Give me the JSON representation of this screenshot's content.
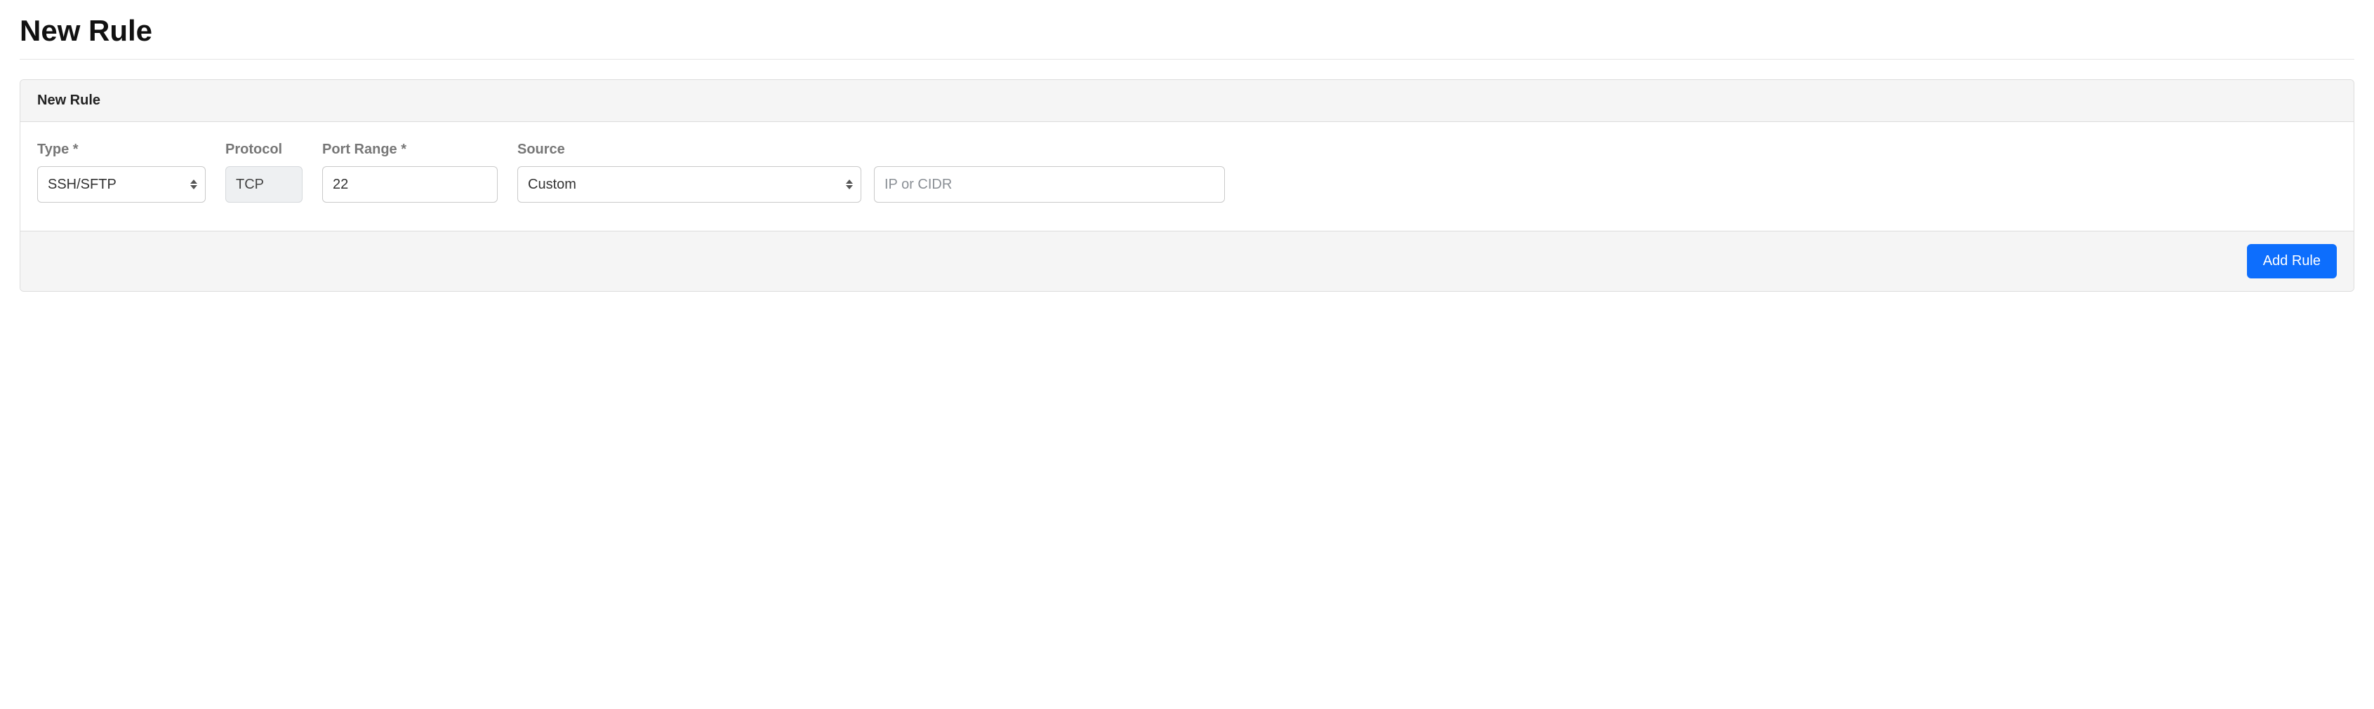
{
  "page": {
    "title": "New Rule"
  },
  "panel": {
    "header": "New Rule",
    "fields": {
      "type": {
        "label": "Type *",
        "selected": "SSH/SFTP"
      },
      "protocol": {
        "label": "Protocol",
        "value": "TCP"
      },
      "port_range": {
        "label": "Port Range *",
        "value": "22"
      },
      "source": {
        "label": "Source",
        "selected": "Custom"
      },
      "ip": {
        "placeholder": "IP or CIDR",
        "value": ""
      }
    },
    "footer": {
      "add_button": "Add Rule"
    }
  }
}
